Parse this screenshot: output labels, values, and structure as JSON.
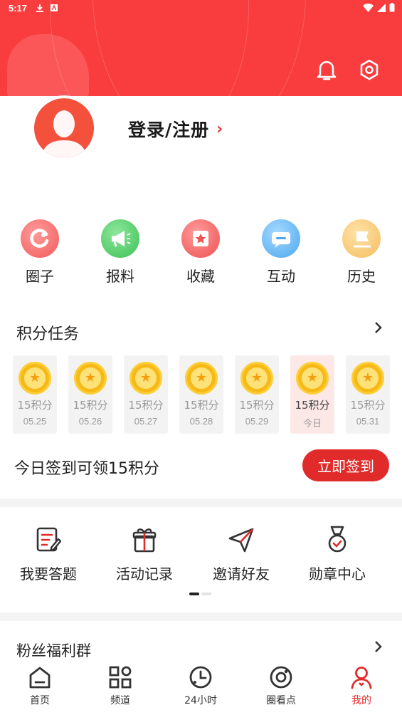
{
  "status_bar": {
    "time": "5:17"
  },
  "header": {
    "bell_icon": "bell-icon",
    "settings_icon": "settings-icon",
    "bg_color": "#f93c3e"
  },
  "profile": {
    "login_label": "登录/注册",
    "chevron": "›"
  },
  "quick_actions": [
    {
      "label": "圈子",
      "icon": "circle-icon",
      "color": "#f46d6d"
    },
    {
      "label": "报料",
      "icon": "megaphone-icon",
      "color": "#4cc964"
    },
    {
      "label": "收藏",
      "icon": "star-icon",
      "color": "#f06060"
    },
    {
      "label": "互动",
      "icon": "chat-icon",
      "color": "#4aa8ef"
    },
    {
      "label": "历史",
      "icon": "flag-icon",
      "color": "#f7c46a"
    }
  ],
  "points": {
    "title": "积分任务",
    "days": [
      {
        "points": "15积分",
        "date": "05.25",
        "today": false
      },
      {
        "points": "15积分",
        "date": "05.26",
        "today": false
      },
      {
        "points": "15积分",
        "date": "05.27",
        "today": false
      },
      {
        "points": "15积分",
        "date": "05.28",
        "today": false
      },
      {
        "points": "15积分",
        "date": "05.29",
        "today": false
      },
      {
        "points": "15积分",
        "date": "今日",
        "today": true
      },
      {
        "points": "15积分",
        "date": "05.31",
        "today": false
      }
    ],
    "checkin_text": "今日签到可领15积分",
    "checkin_button": "立即签到"
  },
  "activities": [
    {
      "label": "我要答题",
      "icon": "quiz-icon"
    },
    {
      "label": "活动记录",
      "icon": "gift-icon"
    },
    {
      "label": "邀请好友",
      "icon": "send-icon"
    },
    {
      "label": "勋章中心",
      "icon": "medal-icon"
    }
  ],
  "fans": {
    "title": "粉丝福利群"
  },
  "bottom_nav": [
    {
      "label": "首页",
      "icon": "home-icon",
      "active": false
    },
    {
      "label": "频道",
      "icon": "grid-icon",
      "active": false
    },
    {
      "label": "24小时",
      "icon": "clock-icon",
      "active": false
    },
    {
      "label": "圈看点",
      "icon": "target-icon",
      "active": false
    },
    {
      "label": "我的",
      "icon": "user-icon",
      "active": true
    }
  ],
  "colors": {
    "accent": "#e12b2b",
    "header": "#f93c3e"
  }
}
